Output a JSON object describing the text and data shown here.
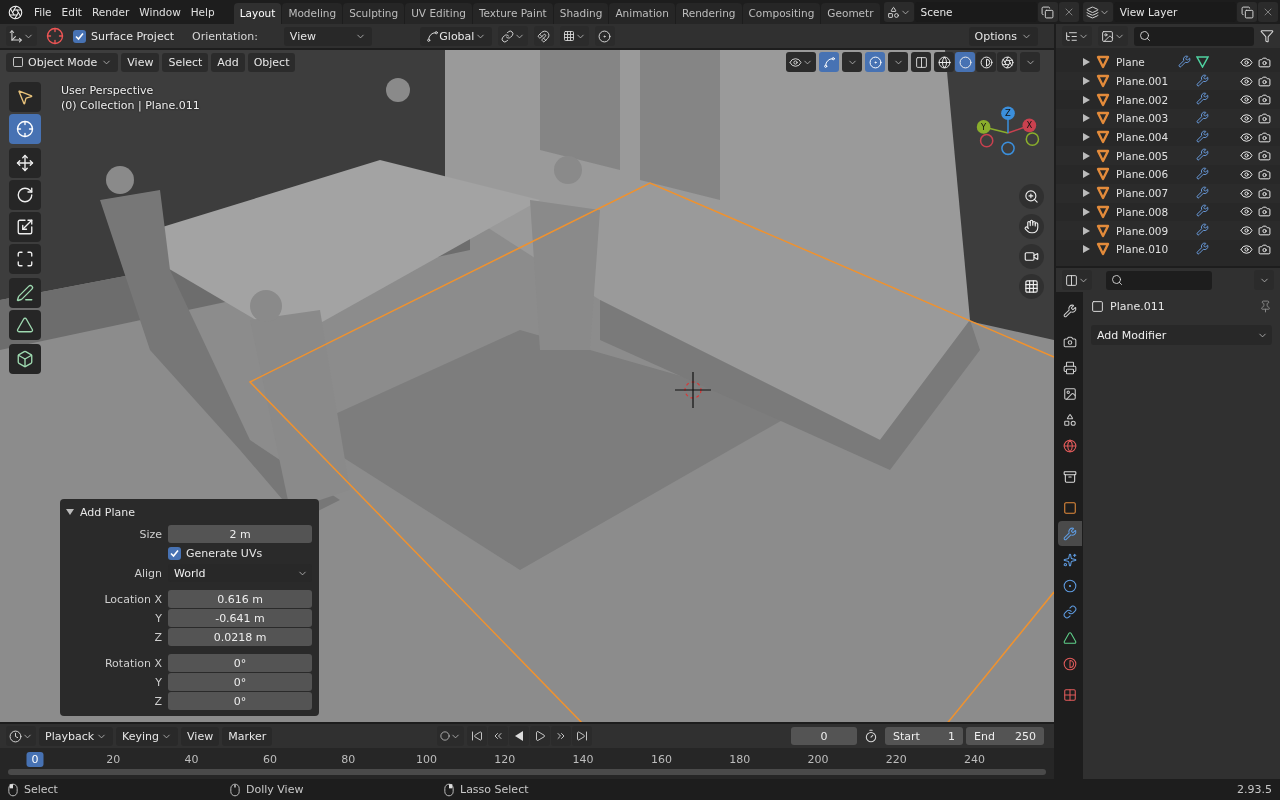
{
  "menu": [
    "File",
    "Edit",
    "Render",
    "Window",
    "Help"
  ],
  "workspaces": [
    {
      "label": "Layout",
      "selected": true
    },
    {
      "label": "Modeling",
      "selected": false
    },
    {
      "label": "Sculpting",
      "selected": false
    },
    {
      "label": "UV Editing",
      "selected": false
    },
    {
      "label": "Texture Paint",
      "selected": false
    },
    {
      "label": "Shading",
      "selected": false
    },
    {
      "label": "Animation",
      "selected": false
    },
    {
      "label": "Rendering",
      "selected": false
    },
    {
      "label": "Compositing",
      "selected": false
    },
    {
      "label": "Geometr",
      "selected": false
    }
  ],
  "scene": "Scene",
  "view_layer": "View Layer",
  "tool_settings": {
    "surface_project": {
      "label": "Surface Project",
      "checked": true
    },
    "orientation_label": "Orientation:",
    "orientation": "View",
    "transform_orientation": "Global",
    "options": "Options"
  },
  "viewport_header": {
    "mode": "Object Mode",
    "menus": [
      "View",
      "Select",
      "Add",
      "Object"
    ],
    "shading": [
      {
        "kind": "wireframe",
        "selected": false
      },
      {
        "kind": "solid",
        "selected": true
      },
      {
        "kind": "material",
        "selected": false
      },
      {
        "kind": "rendered",
        "selected": false
      }
    ]
  },
  "viewport": {
    "perspective": "User Perspective",
    "collection": "(0) Collection | Plane.011"
  },
  "toolbar": [
    [
      {
        "kind": "select",
        "selected": false
      },
      {
        "kind": "cursor",
        "selected": true
      }
    ],
    [
      {
        "kind": "move",
        "selected": false
      },
      {
        "kind": "rotate",
        "selected": false
      },
      {
        "kind": "scale",
        "selected": false
      },
      {
        "kind": "transform",
        "selected": false
      }
    ],
    [
      {
        "kind": "annotate",
        "selected": false
      },
      {
        "kind": "measure",
        "selected": false
      }
    ],
    [
      {
        "kind": "add-cube",
        "selected": false
      }
    ]
  ],
  "gizmo": [
    {
      "label": "X",
      "color": "#c9414f"
    },
    {
      "label": "Y",
      "color": "#8aae2c"
    },
    {
      "label": "Z",
      "color": "#3b8fdc"
    }
  ],
  "operator_panel": {
    "title": "Add Plane",
    "expanded": true,
    "fields": [
      {
        "kind": "number",
        "label": "Size",
        "value": "2 m"
      },
      {
        "kind": "checkbox",
        "label": "Generate UVs",
        "checked": true
      },
      {
        "kind": "dropdown",
        "label": "Align",
        "value": "World"
      },
      {
        "kind": "vector",
        "items": [
          {
            "label": "Location X",
            "value": "0.616 m"
          },
          {
            "label": "Y",
            "value": "-0.641 m"
          },
          {
            "label": "Z",
            "value": "0.0218 m"
          }
        ]
      },
      {
        "kind": "vector",
        "items": [
          {
            "label": "Rotation X",
            "value": "0°"
          },
          {
            "label": "Y",
            "value": "0°"
          },
          {
            "label": "Z",
            "value": "0°"
          }
        ]
      }
    ]
  },
  "outliner": {
    "rows": [
      {
        "name": "Plane",
        "mesh_data": true
      },
      {
        "name": "Plane.001",
        "mesh_data": false
      },
      {
        "name": "Plane.002",
        "mesh_data": false
      },
      {
        "name": "Plane.003",
        "mesh_data": false
      },
      {
        "name": "Plane.004",
        "mesh_data": false
      },
      {
        "name": "Plane.005",
        "mesh_data": false
      },
      {
        "name": "Plane.006",
        "mesh_data": false
      },
      {
        "name": "Plane.007",
        "mesh_data": false
      },
      {
        "name": "Plane.008",
        "mesh_data": false
      },
      {
        "name": "Plane.009",
        "mesh_data": false
      },
      {
        "name": "Plane.010",
        "mesh_data": false
      }
    ]
  },
  "properties": {
    "tabs": [
      [
        {
          "kind": "tool",
          "selected": false
        }
      ],
      [
        {
          "kind": "render",
          "selected": false
        },
        {
          "kind": "output",
          "selected": false
        },
        {
          "kind": "view-layer",
          "selected": false
        },
        {
          "kind": "scene",
          "selected": false
        },
        {
          "kind": "world",
          "selected": false
        }
      ],
      [
        {
          "kind": "collection",
          "selected": false
        }
      ],
      [
        {
          "kind": "object",
          "selected": false
        },
        {
          "kind": "modifiers",
          "selected": true
        },
        {
          "kind": "particles",
          "selected": false
        },
        {
          "kind": "physics",
          "selected": false
        },
        {
          "kind": "constraints",
          "selected": false
        },
        {
          "kind": "data",
          "selected": false
        },
        {
          "kind": "material",
          "selected": false
        }
      ],
      [
        {
          "kind": "texture",
          "selected": false
        }
      ]
    ],
    "object_name": "Plane.011",
    "add_modifier": "Add Modifier"
  },
  "timeline": {
    "menus": [
      {
        "label": "Playback",
        "dropdown": true
      },
      {
        "label": "Keying",
        "dropdown": true
      },
      {
        "label": "View",
        "dropdown": false
      },
      {
        "label": "Marker",
        "dropdown": false
      }
    ],
    "current_frame": "0",
    "start_label": "Start",
    "start": "1",
    "end_label": "End",
    "end": "250",
    "ruler": [
      {
        "label": "0",
        "selected": true
      },
      {
        "label": "20",
        "selected": false
      },
      {
        "label": "40",
        "selected": false
      },
      {
        "label": "60",
        "selected": false
      },
      {
        "label": "80",
        "selected": false
      },
      {
        "label": "100",
        "selected": false
      },
      {
        "label": "120",
        "selected": false
      },
      {
        "label": "140",
        "selected": false
      },
      {
        "label": "160",
        "selected": false
      },
      {
        "label": "180",
        "selected": false
      },
      {
        "label": "200",
        "selected": false
      },
      {
        "label": "220",
        "selected": false
      },
      {
        "label": "240",
        "selected": false
      }
    ]
  },
  "status_bar": {
    "hints": [
      {
        "kind": "left",
        "label": "Select"
      },
      {
        "kind": "middle",
        "label": "Dolly View"
      },
      {
        "kind": "right",
        "label": "Lasso Select"
      }
    ],
    "version": "2.93.5"
  }
}
